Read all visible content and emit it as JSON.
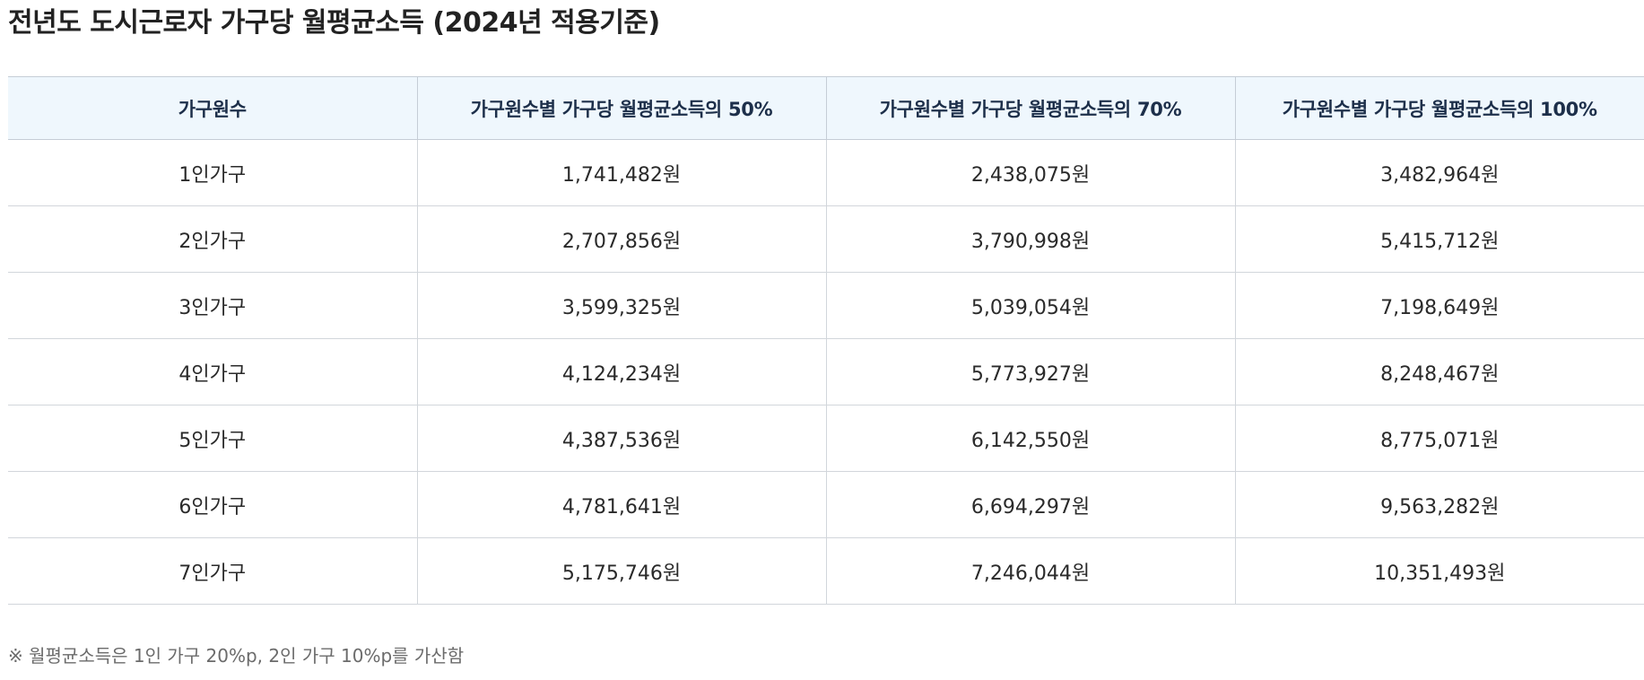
{
  "title": "전년도 도시근로자 가구당 월평균소득 (2024년 적용기준)",
  "table": {
    "headers": [
      "가구원수",
      "가구원수별 가구당 월평균소득의 50%",
      "가구원수별 가구당 월평균소득의 70%",
      "가구원수별 가구당 월평균소득의 100%"
    ],
    "rows": [
      [
        "1인가구",
        "1,741,482원",
        "2,438,075원",
        "3,482,964원"
      ],
      [
        "2인가구",
        "2,707,856원",
        "3,790,998원",
        "5,415,712원"
      ],
      [
        "3인가구",
        "3,599,325원",
        "5,039,054원",
        "7,198,649원"
      ],
      [
        "4인가구",
        "4,124,234원",
        "5,773,927원",
        "8,248,467원"
      ],
      [
        "5인가구",
        "4,387,536원",
        "6,142,550원",
        "8,775,071원"
      ],
      [
        "6인가구",
        "4,781,641원",
        "6,694,297원",
        "9,563,282원"
      ],
      [
        "7인가구",
        "5,175,746원",
        "7,246,044원",
        "10,351,493원"
      ]
    ]
  },
  "footnote": "※ 월평균소득은 1인 가구 20%p, 2인 가구 10%p를 가산함",
  "colors": {
    "header_background": "#eff7fd",
    "header_text": "#1d2f4a",
    "border": "#d2d6db",
    "footnote_text": "#6b6b6b"
  }
}
